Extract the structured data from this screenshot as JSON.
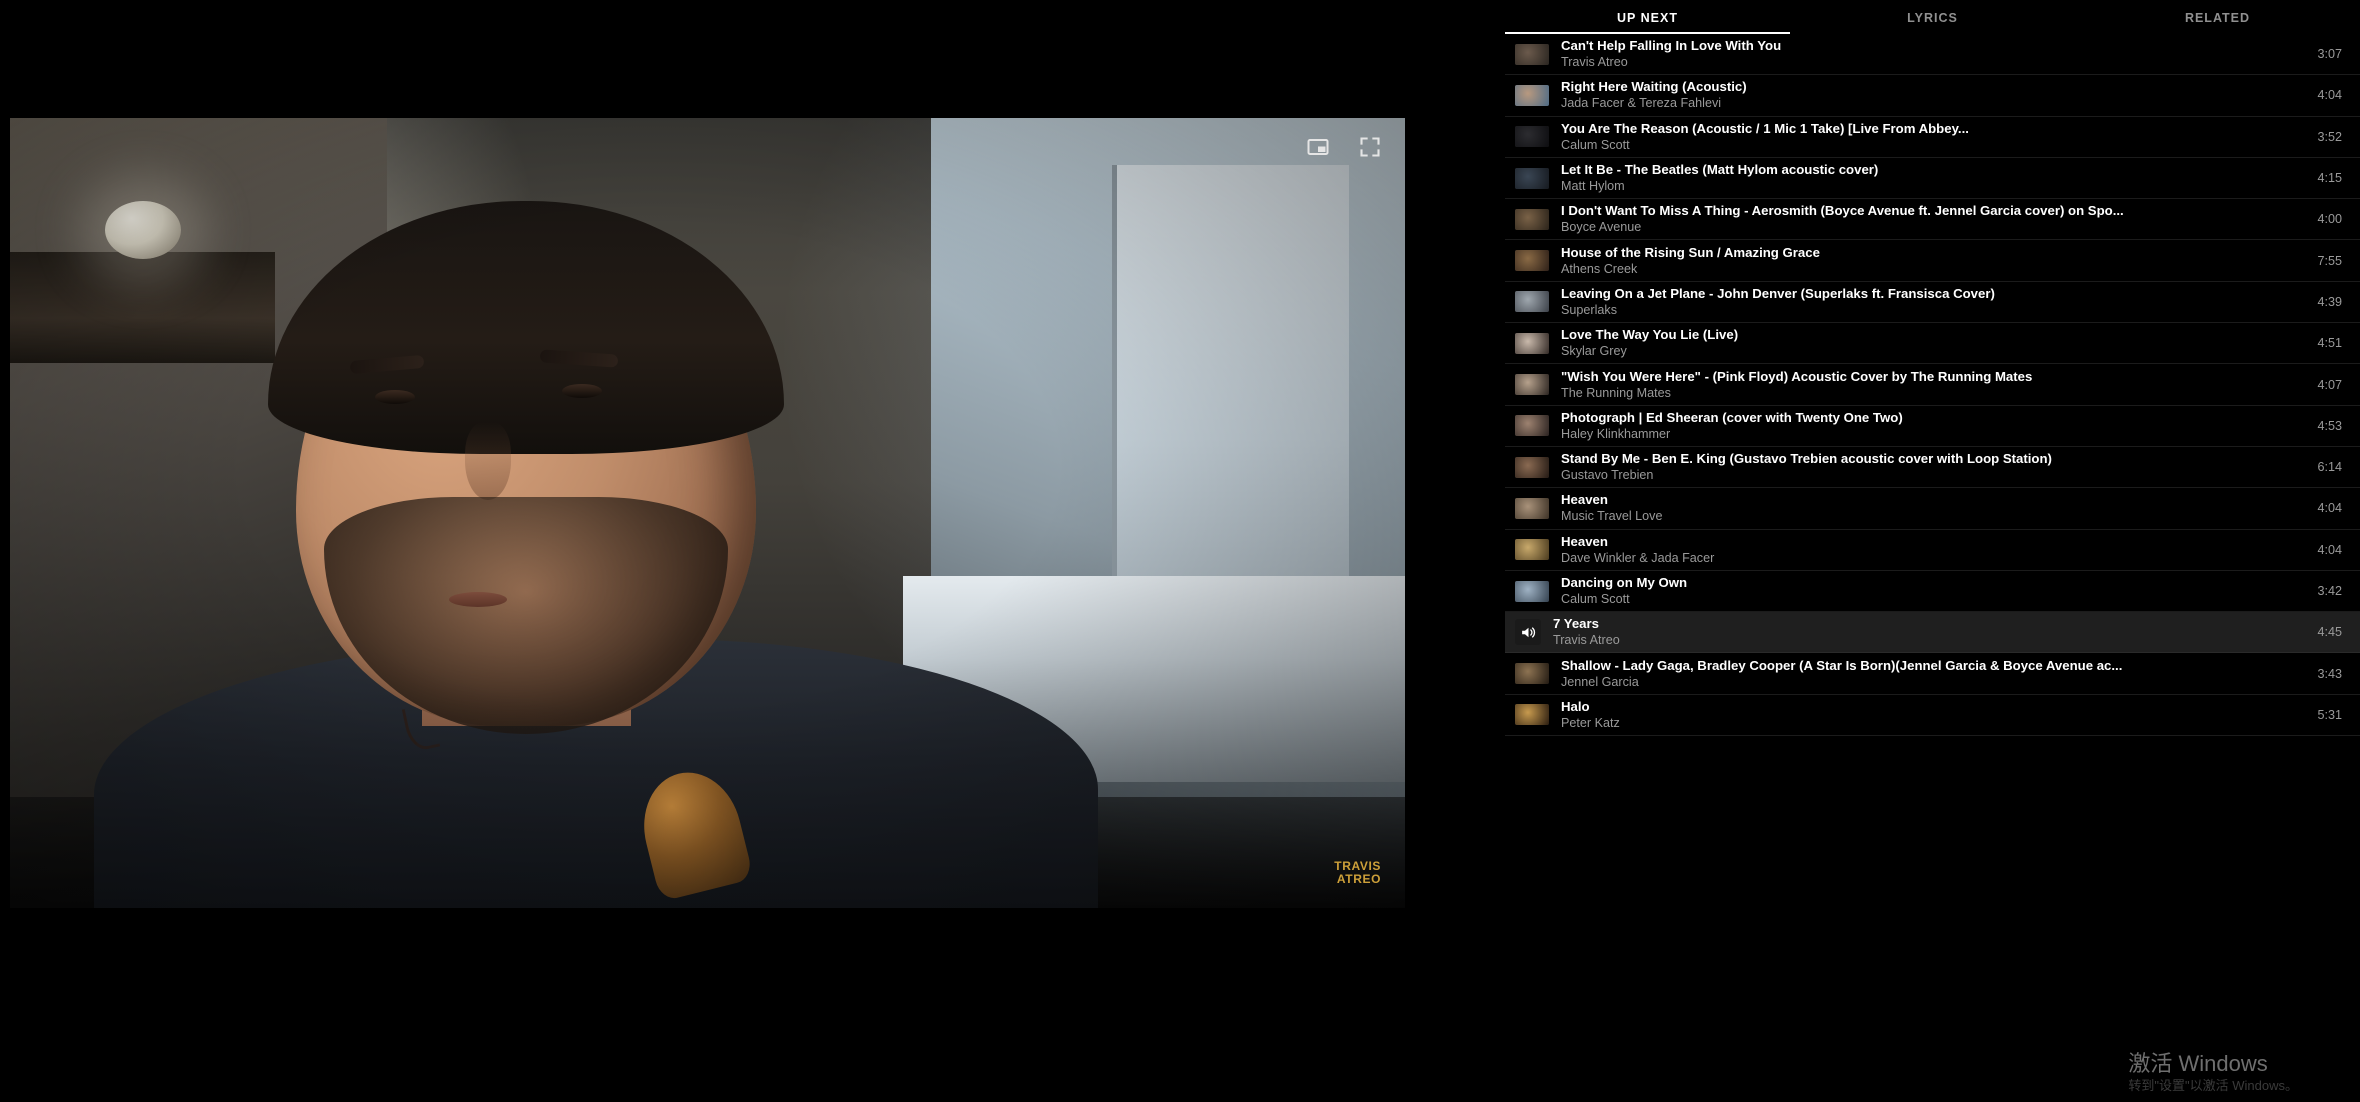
{
  "player": {
    "watermark_line1": "TRAVIS",
    "watermark_line2": "ATREO",
    "controls": {
      "pip_label": "Miniplayer",
      "fullscreen_label": "Full screen"
    }
  },
  "panel": {
    "tabs": [
      {
        "label": "UP NEXT",
        "active": true
      },
      {
        "label": "LYRICS",
        "active": false
      },
      {
        "label": "RELATED",
        "active": false
      }
    ],
    "items": [
      {
        "title": "Can't Help Falling In Love With You",
        "artist": "Travis Atreo",
        "duration": "3:07",
        "playing": false,
        "thumb": [
          "#6b5a4c",
          "#2a2520"
        ]
      },
      {
        "title": "Right Here Waiting (Acoustic)",
        "artist": "Jada Facer & Tereza Fahlevi",
        "duration": "4:04",
        "playing": false,
        "thumb": [
          "#b8997f",
          "#4e6b86"
        ]
      },
      {
        "title": "You Are The Reason (Acoustic / 1 Mic 1 Take) [Live From Abbey...",
        "artist": "Calum Scott",
        "duration": "3:52",
        "playing": false,
        "thumb": [
          "#2c2c30",
          "#0d0d10"
        ]
      },
      {
        "title": "Let It Be - The Beatles (Matt Hylom acoustic cover)",
        "artist": "Matt Hylom",
        "duration": "4:15",
        "playing": false,
        "thumb": [
          "#3a4654",
          "#161a20"
        ]
      },
      {
        "title": "I Don't Want To Miss A Thing - Aerosmith (Boyce Avenue ft. Jennel Garcia cover) on Spo...",
        "artist": "Boyce Avenue",
        "duration": "4:00",
        "playing": false,
        "thumb": [
          "#7a6247",
          "#2b231a"
        ]
      },
      {
        "title": "House of the Rising Sun / Amazing Grace",
        "artist": "Athens Creek",
        "duration": "7:55",
        "playing": false,
        "thumb": [
          "#8a6a45",
          "#2e2018"
        ]
      },
      {
        "title": "Leaving On a Jet Plane - John Denver (Superlaks ft. Fransisca Cover)",
        "artist": "Superlaks",
        "duration": "4:39",
        "playing": false,
        "thumb": [
          "#9fa7ae",
          "#3b4048"
        ]
      },
      {
        "title": "Love The Way You Lie (Live)",
        "artist": "Skylar Grey",
        "duration": "4:51",
        "playing": false,
        "thumb": [
          "#c9b9ab",
          "#332a26"
        ]
      },
      {
        "title": "\"Wish You Were Here\" - (Pink Floyd) Acoustic Cover by The Running Mates",
        "artist": "The Running Mates",
        "duration": "4:07",
        "playing": false,
        "thumb": [
          "#b6a18c",
          "#2b2420"
        ]
      },
      {
        "title": "Photograph | Ed Sheeran (cover with Twenty One Two)",
        "artist": "Haley Klinkhammer",
        "duration": "4:53",
        "playing": false,
        "thumb": [
          "#9d8270",
          "#2a2220"
        ]
      },
      {
        "title": "Stand By Me - Ben E. King (Gustavo Trebien acoustic cover with Loop Station)",
        "artist": "Gustavo Trebien",
        "duration": "6:14",
        "playing": false,
        "thumb": [
          "#8a6a52",
          "#241a14"
        ]
      },
      {
        "title": "Heaven",
        "artist": "Music Travel Love",
        "duration": "4:04",
        "playing": false,
        "thumb": [
          "#a9927a",
          "#3d3226"
        ]
      },
      {
        "title": "Heaven",
        "artist": "Dave Winkler & Jada Facer",
        "duration": "4:04",
        "playing": false,
        "thumb": [
          "#c8a96b",
          "#4a3a1e"
        ]
      },
      {
        "title": "Dancing on My Own",
        "artist": "Calum Scott",
        "duration": "3:42",
        "playing": false,
        "thumb": [
          "#9fb2c4",
          "#33414f"
        ]
      },
      {
        "title": "7 Years",
        "artist": "Travis Atreo",
        "duration": "4:45",
        "playing": true,
        "thumb": [
          "#1a1a1a",
          "#101010"
        ]
      },
      {
        "title": "Shallow - Lady Gaga, Bradley Cooper (A Star Is Born)(Jennel Garcia & Boyce Avenue ac...",
        "artist": "Jennel Garcia",
        "duration": "3:43",
        "playing": false,
        "thumb": [
          "#8d7352",
          "#221a12"
        ]
      },
      {
        "title": "Halo",
        "artist": "Peter Katz",
        "duration": "5:31",
        "playing": false,
        "thumb": [
          "#c79a4e",
          "#2a1c10"
        ]
      }
    ]
  },
  "os_watermark": {
    "line1": "激活 Windows",
    "line2": "转到\"设置\"以激活 Windows。"
  }
}
